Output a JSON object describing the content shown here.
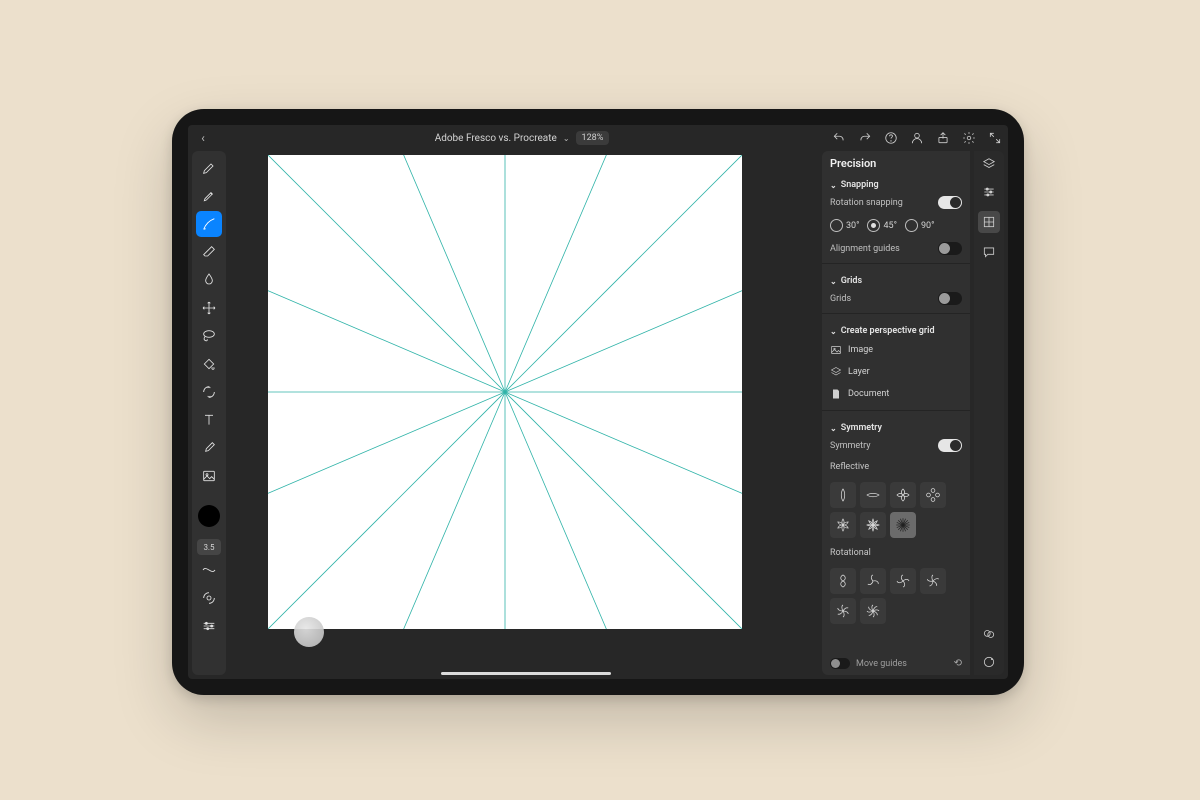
{
  "topbar": {
    "title": "Adobe Fresco vs. Procreate",
    "zoom": "128%"
  },
  "toolbar": {
    "brushSize": "3.5"
  },
  "panel": {
    "title": "Precision",
    "snapping": {
      "header": "Snapping",
      "rotationLabel": "Rotation snapping",
      "angles": [
        "30°",
        "45°",
        "90°"
      ],
      "selectedAngleIndex": 1,
      "alignmentLabel": "Alignment guides"
    },
    "grids": {
      "header": "Grids",
      "label": "Grids"
    },
    "perspective": {
      "header": "Create perspective grid",
      "items": [
        "Image",
        "Layer",
        "Document"
      ]
    },
    "symmetry": {
      "header": "Symmetry",
      "label": "Symmetry",
      "reflectiveLabel": "Reflective",
      "rotationalLabel": "Rotational"
    },
    "footer": {
      "moveGuides": "Move guides"
    }
  }
}
